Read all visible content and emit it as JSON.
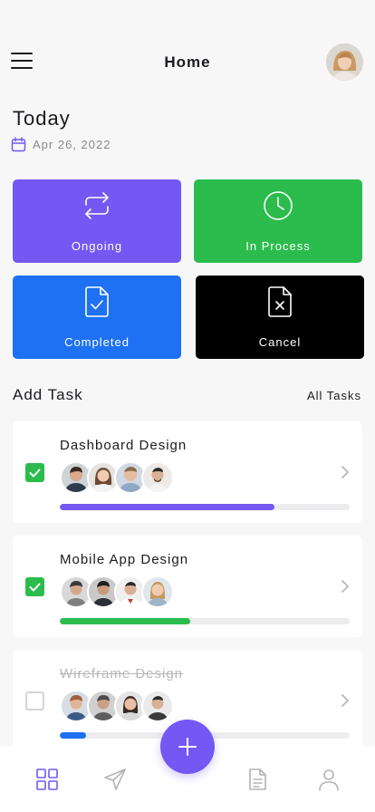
{
  "header": {
    "title": "Home",
    "menu_icon": "hamburger-icon"
  },
  "today": {
    "heading": "Today",
    "date": "Apr 26, 2022"
  },
  "status_tiles": [
    {
      "label": "Ongoing",
      "icon": "repeat-icon",
      "color": "#7358f4"
    },
    {
      "label": "In Process",
      "icon": "clock-icon",
      "color": "#2bbc4d"
    },
    {
      "label": "Completed",
      "icon": "file-check-icon",
      "color": "#1d71f2"
    },
    {
      "label": "Cancel",
      "icon": "file-x-icon",
      "color": "#000000"
    }
  ],
  "tasks_section": {
    "title": "Add Task",
    "link": "All Tasks"
  },
  "tasks": [
    {
      "title": "Dashboard Design",
      "checked": true,
      "progress": 0.74,
      "bar_color": "#7358f4"
    },
    {
      "title": "Mobile App Design",
      "checked": true,
      "progress": 0.45,
      "bar_color": "#2bbc4d"
    },
    {
      "title": "Wireframe Design",
      "checked": false,
      "strikethrough": true,
      "progress": 0.09,
      "bar_color": "#1d71f2"
    }
  ],
  "tabbar": {
    "items": [
      "grid-icon",
      "send-icon",
      "add-icon",
      "document-icon",
      "user-icon"
    ],
    "active": "grid-icon",
    "accent": "#7358f4"
  }
}
